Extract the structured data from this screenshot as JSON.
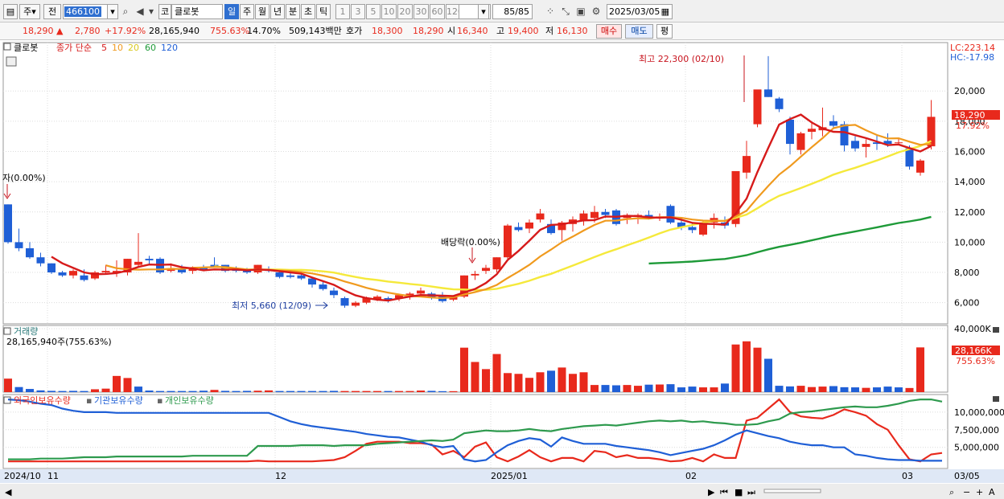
{
  "toolbar": {
    "type_label": "주",
    "prev_label": "전",
    "code": "466100",
    "name_prefix": "코",
    "name": "클로봇",
    "periods": [
      "일",
      "주",
      "월",
      "년",
      "분",
      "초",
      "틱"
    ],
    "selected_period": "일",
    "intervals": [
      "1",
      "3",
      "5",
      "10",
      "20",
      "30",
      "60",
      "120"
    ],
    "count": "85/85",
    "date": "2025/03/05"
  },
  "quote": {
    "price": "18,290",
    "direction": "▲",
    "change": "2,780",
    "change_pct": "+17.92%",
    "volume": "28,165,940",
    "volume_ratio": "755.63%",
    "turnover": "14.70%",
    "amount": "509,143백만",
    "ask_label": "호가",
    "ask": "18,300",
    "bid": "18,290",
    "open_label": "시",
    "open": "16,340",
    "high_label": "고",
    "high": "19,400",
    "low_label": "저",
    "low": "16,130",
    "buy_label": "매수",
    "sell_label": "매도",
    "avg_label": "평"
  },
  "price_panel": {
    "name": "클로봇",
    "ma_label": "종가 단순",
    "lc": "LC:223.14",
    "hc": "HC:-17.98",
    "price_tag": "18,290",
    "pct_tag": "17.92%",
    "annotations": {
      "high": "최고 22,300 (02/10)",
      "low": "최저 5,660 (12/09)",
      "div": "배당락(0.00%)",
      "left": "자(0.00%)"
    }
  },
  "volume_panel": {
    "title": "거래량",
    "value": "28,165,940주(755.63%)",
    "tag": "28,166K",
    "tag_pct": "755.63%"
  },
  "holding_panel": {
    "legend": [
      "외국인보유수량",
      "기관보유수량",
      "개인보유수량"
    ]
  },
  "x_axis": {
    "labels": [
      "2024/10",
      "11",
      "12",
      "2025/01",
      "02",
      "03"
    ],
    "right_label": "03/05"
  },
  "colors": {
    "up": "#e8291c",
    "down": "#1f5fd6",
    "ma5": "#d61a1a",
    "ma10": "#f09a1e",
    "ma20": "#f5e93b",
    "ma60": "#1e9a38",
    "ma120": "#1f5fd6",
    "foreign": "#e8291c",
    "institution": "#1f5fd6",
    "individual": "#2e9a4e"
  },
  "chart_data": [
    {
      "type": "candlestick",
      "title": "클로봇",
      "ylim": [
        4600,
        23200
      ],
      "y_ticks": [
        6000,
        8000,
        10000,
        12000,
        14000,
        16000,
        18000,
        20000
      ],
      "moving_averages": [
        {
          "name": "5",
          "color": "#d61a1a"
        },
        {
          "name": "10",
          "color": "#f09a1e"
        },
        {
          "name": "20",
          "color": "#f5e93b"
        },
        {
          "name": "60",
          "color": "#1e9a38"
        },
        {
          "name": "120",
          "color": "#1f5fd6"
        }
      ],
      "candles": [
        [
          12500,
          12500,
          9900,
          10000
        ],
        [
          10000,
          10900,
          9400,
          9600
        ],
        [
          9600,
          10000,
          8900,
          9000
        ],
        [
          9000,
          9300,
          8400,
          8600
        ],
        [
          8600,
          8600,
          7900,
          8000
        ],
        [
          8000,
          8100,
          7700,
          7800
        ],
        [
          7800,
          8200,
          7600,
          8100
        ],
        [
          7800,
          8200,
          7400,
          7500
        ],
        [
          7600,
          8100,
          7500,
          8000
        ],
        [
          8000,
          8500,
          7900,
          8100
        ],
        [
          8000,
          8800,
          7700,
          8100
        ],
        [
          8000,
          8900,
          7800,
          8900
        ],
        [
          8500,
          10600,
          8300,
          8700
        ],
        [
          8900,
          9100,
          8500,
          8800
        ],
        [
          8900,
          9000,
          7900,
          8000
        ],
        [
          8100,
          8600,
          8000,
          8200
        ],
        [
          8200,
          8500,
          7900,
          8000
        ],
        [
          8100,
          8400,
          7900,
          8300
        ],
        [
          8300,
          8500,
          8100,
          8200
        ],
        [
          8500,
          9000,
          8300,
          8300
        ],
        [
          8500,
          8500,
          8000,
          8100
        ],
        [
          8200,
          8400,
          8000,
          8100
        ],
        [
          8100,
          8300,
          7900,
          8000
        ],
        [
          8000,
          8500,
          7900,
          8500
        ],
        [
          8200,
          8400,
          8000,
          8100
        ],
        [
          8000,
          8100,
          7600,
          7700
        ],
        [
          7800,
          8000,
          7600,
          7700
        ],
        [
          7800,
          8000,
          7500,
          7600
        ],
        [
          7600,
          7700,
          7000,
          7200
        ],
        [
          7200,
          7400,
          6800,
          6900
        ],
        [
          6800,
          7000,
          6300,
          6500
        ],
        [
          6300,
          6400,
          5660,
          5800
        ],
        [
          5800,
          6100,
          5700,
          6000
        ],
        [
          6000,
          6400,
          5900,
          6300
        ],
        [
          6200,
          6500,
          6100,
          6400
        ],
        [
          6300,
          6400,
          6000,
          6200
        ],
        [
          6300,
          6600,
          6100,
          6500
        ],
        [
          6400,
          6700,
          6200,
          6600
        ],
        [
          6600,
          7000,
          6400,
          6800
        ],
        [
          6600,
          6700,
          6200,
          6300
        ],
        [
          6500,
          6700,
          6000,
          6100
        ],
        [
          6200,
          6400,
          6100,
          6400
        ],
        [
          6400,
          7800,
          6300,
          7800
        ],
        [
          7800,
          8100,
          7500,
          7900
        ],
        [
          8100,
          8500,
          7900,
          8300
        ],
        [
          8200,
          9000,
          8000,
          9000
        ],
        [
          9000,
          11200,
          8900,
          11100
        ],
        [
          11000,
          11300,
          10700,
          10800
        ],
        [
          10900,
          11500,
          10600,
          11300
        ],
        [
          11500,
          12200,
          11300,
          11900
        ],
        [
          11200,
          11500,
          10500,
          10600
        ],
        [
          10800,
          11400,
          10100,
          11300
        ],
        [
          11200,
          11700,
          10700,
          11500
        ],
        [
          11400,
          12100,
          11100,
          11900
        ],
        [
          11600,
          12400,
          11300,
          12000
        ],
        [
          12000,
          12200,
          11600,
          11800
        ],
        [
          12100,
          12200,
          11100,
          11200
        ],
        [
          11600,
          11900,
          11200,
          11800
        ],
        [
          11700,
          11900,
          11200,
          11800
        ],
        [
          11800,
          12100,
          11500,
          11600
        ],
        [
          11600,
          11900,
          11400,
          11700
        ],
        [
          12400,
          12500,
          11200,
          11300
        ],
        [
          11300,
          11600,
          10800,
          11000
        ],
        [
          11000,
          11300,
          10600,
          10800
        ],
        [
          10500,
          11400,
          10400,
          11300
        ],
        [
          11300,
          11900,
          10900,
          11600
        ],
        [
          11300,
          11700,
          10900,
          11100
        ],
        [
          11200,
          14700,
          11000,
          14700
        ],
        [
          14600,
          16700,
          14200,
          15700
        ],
        [
          17800,
          19800,
          17600,
          20100
        ],
        [
          20100,
          22300,
          19600,
          19600
        ],
        [
          19500,
          19600,
          18600,
          18800
        ],
        [
          18100,
          18300,
          15800,
          16500
        ],
        [
          16100,
          17300,
          15800,
          17200
        ],
        [
          17300,
          17900,
          16800,
          17500
        ],
        [
          17400,
          18900,
          17000,
          17600
        ],
        [
          18000,
          18400,
          17500,
          17700
        ],
        [
          17800,
          18000,
          16000,
          16400
        ],
        [
          16700,
          17000,
          16000,
          16200
        ],
        [
          16300,
          16800,
          15600,
          16500
        ],
        [
          16600,
          17100,
          16100,
          16500
        ],
        [
          16700,
          17200,
          16300,
          16500
        ],
        [
          16600,
          16900,
          16400,
          16600
        ],
        [
          16200,
          16400,
          14800,
          15000
        ],
        [
          14600,
          15500,
          14400,
          15400
        ],
        [
          16340,
          19400,
          16130,
          18290
        ]
      ]
    },
    {
      "type": "bar",
      "title": "거래량",
      "ylim": [
        0,
        42000
      ],
      "y_ticks": [
        40000
      ],
      "unit": "K",
      "values": [
        8500,
        3200,
        2000,
        1100,
        800,
        700,
        800,
        700,
        1800,
        2200,
        10200,
        8900,
        3500,
        1000,
        700,
        700,
        700,
        700,
        900,
        1400,
        800,
        700,
        800,
        900,
        1100,
        700,
        700,
        700,
        700,
        700,
        800,
        700,
        700,
        700,
        700,
        700,
        700,
        700,
        1000,
        800,
        600,
        600,
        28000,
        19000,
        14500,
        24000,
        12000,
        11500,
        9000,
        12500,
        13500,
        15500,
        11500,
        12500,
        4500,
        4500,
        4300,
        4500,
        4000,
        4700,
        4800,
        5000,
        3000,
        3500,
        3000,
        3000,
        5400,
        30000,
        32000,
        28000,
        21000,
        4000,
        3600,
        4000,
        3200,
        3500,
        3800,
        3100,
        3000,
        2700,
        3000,
        3500,
        3000,
        2600,
        28166
      ],
      "colors_up": [
        true,
        false,
        false,
        false,
        false,
        false,
        false,
        false,
        true,
        true,
        true,
        true,
        false,
        false,
        false,
        false,
        false,
        false,
        false,
        true,
        false,
        false,
        false,
        true,
        true,
        false,
        false,
        false,
        false,
        false,
        false,
        true,
        true,
        true,
        true,
        false,
        true,
        true,
        true,
        false,
        false,
        true,
        true,
        true,
        true,
        true,
        true,
        true,
        true,
        true,
        false,
        true,
        true,
        true,
        true,
        false,
        false,
        true,
        true,
        false,
        true,
        false,
        false,
        false,
        true,
        true,
        false,
        true,
        true,
        true,
        false,
        false,
        false,
        true,
        true,
        true,
        false,
        false,
        false,
        true,
        false,
        false,
        false,
        true,
        true
      ]
    },
    {
      "type": "line",
      "title": "보유수량",
      "ylim": [
        2000000,
        12500000
      ],
      "y_ticks": [
        5000000,
        7500000,
        10000000
      ],
      "series": [
        {
          "name": "외국인보유수량",
          "color": "#e8291c",
          "values": [
            3000000,
            3000000,
            3000000,
            3000000,
            3000000,
            3000000,
            3000000,
            3000000,
            3000000,
            3000000,
            3000000,
            3000000,
            3000000,
            3000000,
            3000000,
            3000000,
            3000000,
            3000000,
            3000000,
            3000000,
            3000000,
            3000000,
            3000000,
            3100000,
            3000000,
            3000000,
            3000000,
            3000000,
            3000000,
            3100000,
            3200000,
            3600000,
            4500000,
            5500000,
            5800000,
            5800000,
            5800000,
            5600000,
            5600000,
            5400000,
            4000000,
            4500000,
            3600000,
            5100000,
            5700000,
            3600000,
            3000000,
            3700000,
            4600000,
            3600000,
            3000000,
            3500000,
            3500000,
            3000000,
            4500000,
            4300000,
            3600000,
            3900000,
            3500000,
            3500000,
            3300000,
            3000000,
            3100000,
            3500000,
            3000000,
            4000000,
            3500000,
            3500000,
            8800000,
            9200000,
            10500000,
            11800000,
            10000000,
            9400000,
            9200000,
            9100000,
            9600000,
            10400000,
            10000000,
            9500000,
            8300000,
            7500000,
            5300000,
            3300000,
            3000000,
            4000000,
            4200000
          ]
        },
        {
          "name": "기관보유수량",
          "color": "#1f5fd6",
          "values": [
            11800000,
            11700000,
            11500000,
            11200000,
            11000000,
            10500000,
            10200000,
            10000000,
            10000000,
            10000000,
            9900000,
            9900000,
            9900000,
            9900000,
            9900000,
            9900000,
            9900000,
            9900000,
            9900000,
            9900000,
            9900000,
            9900000,
            9900000,
            9900000,
            9900000,
            9300000,
            8700000,
            8300000,
            8000000,
            7800000,
            7600000,
            7400000,
            7200000,
            6900000,
            6700000,
            6500000,
            6400000,
            6100000,
            5800000,
            5300000,
            5000000,
            5200000,
            3300000,
            3000000,
            3200000,
            4300000,
            5300000,
            5900000,
            6300000,
            6100000,
            5100000,
            6400000,
            5900000,
            5500000,
            5500000,
            5500000,
            5200000,
            5000000,
            4800000,
            4600000,
            4300000,
            3900000,
            4200000,
            4500000,
            4800000,
            5300000,
            6000000,
            6800000,
            7400000,
            7000000,
            6600000,
            6300000,
            5800000,
            5500000,
            5300000,
            5300000,
            5000000,
            5000000,
            4000000,
            3800000,
            3500000,
            3300000,
            3200000,
            3200000,
            3100000,
            3100000,
            3100000
          ]
        },
        {
          "name": "개인보유수량",
          "color": "#2e9a4e",
          "values": [
            3300000,
            3300000,
            3300000,
            3400000,
            3400000,
            3400000,
            3500000,
            3600000,
            3600000,
            3600000,
            3700000,
            3700000,
            3700000,
            3700000,
            3700000,
            3700000,
            3700000,
            3800000,
            3800000,
            3800000,
            3800000,
            3800000,
            3800000,
            5200000,
            5200000,
            5200000,
            5200000,
            5300000,
            5300000,
            5300000,
            5200000,
            5300000,
            5300000,
            5300000,
            5500000,
            5600000,
            5700000,
            5800000,
            5900000,
            6000000,
            5900000,
            6100000,
            7000000,
            7200000,
            7400000,
            7300000,
            7300000,
            7400000,
            7600000,
            7400000,
            7300000,
            7600000,
            7800000,
            8000000,
            8100000,
            8200000,
            8100000,
            8300000,
            8500000,
            8700000,
            8800000,
            8700000,
            8800000,
            8600000,
            8700000,
            8500000,
            8400000,
            8200000,
            8200000,
            8300000,
            8700000,
            9000000,
            9800000,
            10000000,
            10100000,
            10300000,
            10500000,
            10700000,
            10800000,
            10700000,
            10700000,
            10900000,
            11200000,
            11600000,
            11800000,
            11800000,
            11500000
          ]
        }
      ]
    }
  ]
}
